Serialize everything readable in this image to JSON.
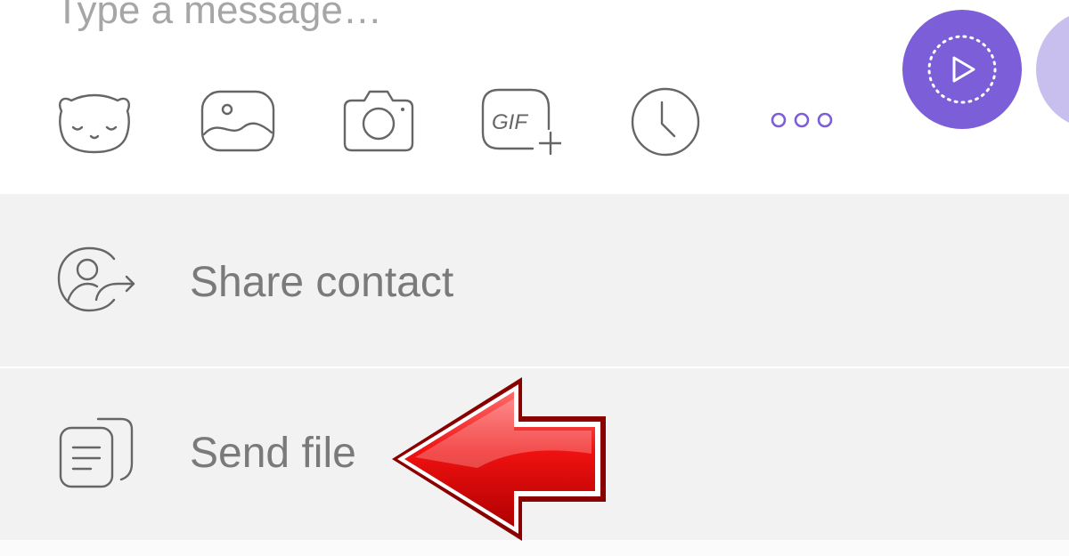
{
  "composer": {
    "placeholder": "Type a message…",
    "toolbar": [
      {
        "name": "sticker-icon"
      },
      {
        "name": "gallery-icon"
      },
      {
        "name": "camera-icon"
      },
      {
        "name": "gif-icon",
        "label": "GIF"
      },
      {
        "name": "clock-icon"
      },
      {
        "name": "more-dots-icon"
      }
    ],
    "buttons": {
      "primary": {
        "icon": "video-message-icon",
        "color": "#7b5ed8"
      },
      "secondary": {
        "color": "#c9bfef"
      }
    }
  },
  "attach_menu": {
    "items": [
      {
        "label": "Share contact",
        "icon": "share-contact-icon"
      },
      {
        "label": "Send file",
        "icon": "send-file-icon"
      }
    ]
  },
  "annotation": {
    "icon": "red-arrow-icon",
    "color": "#e10000"
  },
  "colors": {
    "accent": "#7b5ed8",
    "menu_bg": "#f2f2f2",
    "icon_stroke": "#666666",
    "text": "#7a7a7a"
  }
}
